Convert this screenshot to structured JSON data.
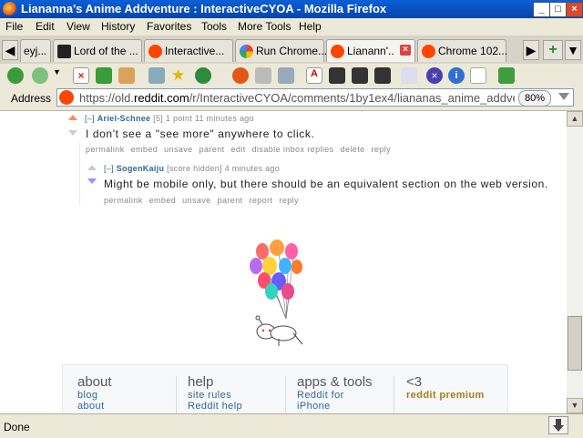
{
  "window": {
    "title": "Liananna's Anime Addventure : InteractiveCYOA - Mozilla Firefox"
  },
  "menu": [
    "File",
    "Edit",
    "View",
    "History",
    "Favorites",
    "Tools",
    "More Tools",
    "Help"
  ],
  "tabs": [
    {
      "label": "eyj..."
    },
    {
      "label": "Lord of the ..."
    },
    {
      "label": "Interactive..."
    },
    {
      "label": "Run Chrome..."
    },
    {
      "label": "Lianann'..."
    },
    {
      "label": "Chrome 102..."
    }
  ],
  "new_tab_label": "+",
  "address": {
    "label": "Address",
    "url_prefix": "https://old.",
    "url_domain": "reddit.com",
    "url_suffix": "/r/InteractiveCYOA/comments/1by1ex4/liananas_anime_addver",
    "zoom": "80%"
  },
  "comments": [
    {
      "toggle": "[–]",
      "author": "Ariel-Schnee",
      "flair": "[5]",
      "meta": "1 point 11 minutes ago",
      "text": "I don't see a \"see more\" anywhere to click.",
      "buttons": [
        "permalink",
        "embed",
        "unsave",
        "parent",
        "edit",
        "disable inbox replies",
        "delete",
        "reply"
      ]
    },
    {
      "toggle": "[–]",
      "author": "SogenKaiju",
      "meta": "[score hidden] 4 minutes ago",
      "text": "Might be mobile only, but there should be an equivalent section on the web version.",
      "buttons": [
        "permalink",
        "embed",
        "unsave",
        "parent",
        "report",
        "reply"
      ]
    }
  ],
  "footer": [
    {
      "heading": "about",
      "links": [
        "blog",
        "about"
      ]
    },
    {
      "heading": "help",
      "links": [
        "site rules",
        "Reddit help"
      ]
    },
    {
      "heading": "apps & tools",
      "links": [
        "Reddit for",
        "iPhone"
      ]
    },
    {
      "heading": "<3",
      "links": [
        "reddit premium"
      ]
    }
  ],
  "status": {
    "text": "Done"
  },
  "colors": {
    "titlebar": "#0a5fd8",
    "reddit": "#ff4500",
    "link": "#336699",
    "premium": "#a67d1c"
  }
}
